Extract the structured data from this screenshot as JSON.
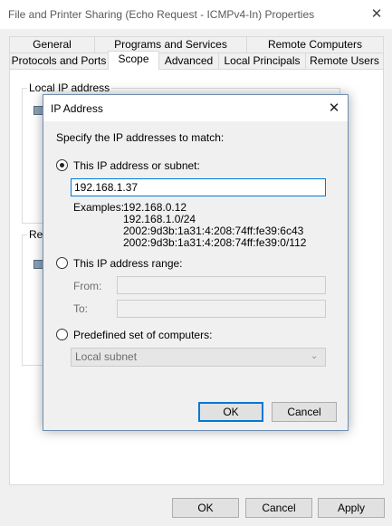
{
  "outer_window": {
    "title": "File and Printer Sharing (Echo Request - ICMPv4-In) Properties",
    "close_glyph": "✕",
    "tabs_row1": [
      "General",
      "Programs and Services",
      "Remote Computers"
    ],
    "tabs_row2": [
      "Protocols and Ports",
      "Scope",
      "Advanced",
      "Local Principals",
      "Remote Users"
    ],
    "active_tab": "Scope",
    "local_group_label": "Local IP address",
    "remote_group_label": "Re",
    "buttons": {
      "ok": "OK",
      "cancel": "Cancel",
      "apply": "Apply"
    }
  },
  "dialog": {
    "title": "IP Address",
    "close_glyph": "✕",
    "instruction": "Specify the IP addresses to match:",
    "option_subnet": {
      "label": "This IP address or subnet:",
      "selected": true,
      "value": "192.168.1.37",
      "examples_label": "Examples:",
      "examples": [
        "192.168.0.12",
        "192.168.1.0/24",
        "2002:9d3b:1a31:4:208:74ff:fe39:6c43",
        "2002:9d3b:1a31:4:208:74ff:fe39:0/112"
      ]
    },
    "option_range": {
      "label": "This IP address range:",
      "selected": false,
      "from_label": "From:",
      "to_label": "To:",
      "from_value": "",
      "to_value": ""
    },
    "option_predefined": {
      "label": "Predefined set of computers:",
      "selected": false,
      "selected_value": "Local subnet"
    },
    "buttons": {
      "ok": "OK",
      "cancel": "Cancel"
    }
  },
  "colors": {
    "accent": "#0078d7",
    "disabled_text": "#6d6d6d",
    "window_bg": "#f0f0f0"
  }
}
